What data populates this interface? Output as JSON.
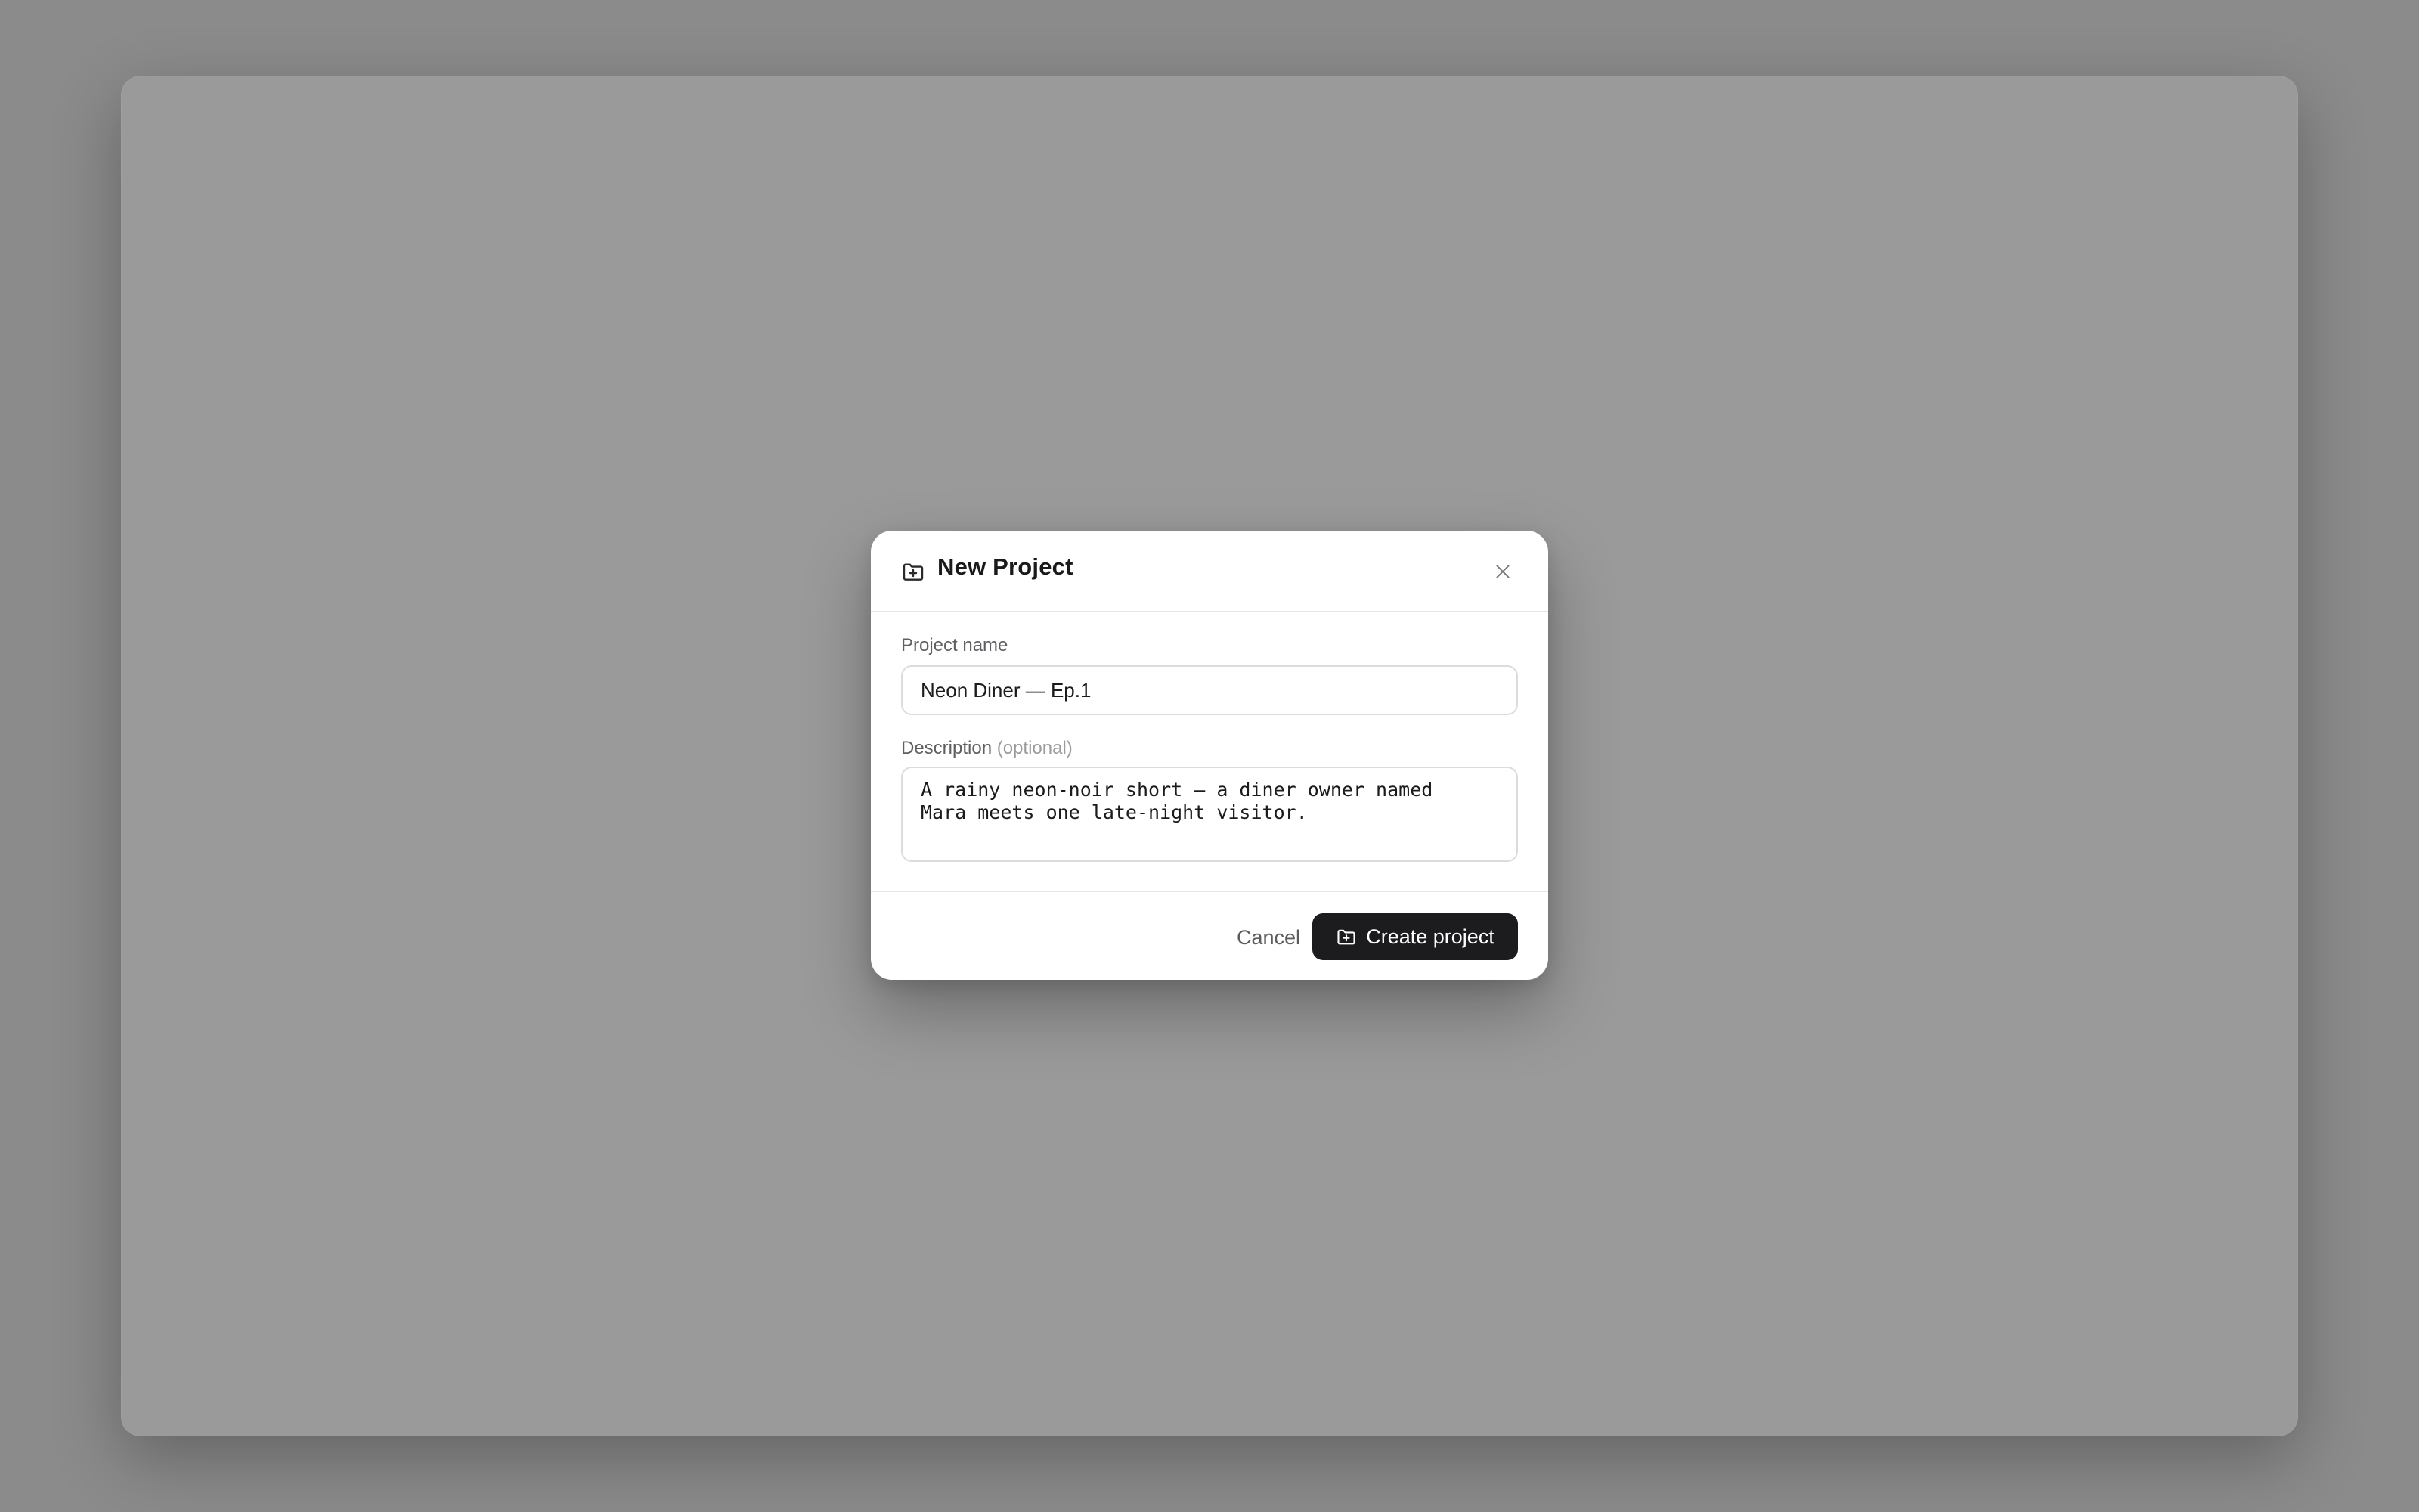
{
  "dialog": {
    "title": "New Project",
    "title_icon": "folder-plus-icon",
    "close_icon": "close-icon"
  },
  "form": {
    "name_label": "Project name",
    "name_value": "Neon Diner — Ep.1",
    "description_label": "Description",
    "description_hint": "(optional)",
    "description_value": "A rainy neon-noir short — a diner owner named\nMara meets one late-night visitor."
  },
  "footer": {
    "cancel_label": "Cancel",
    "create_label": "Create project",
    "create_icon": "folder-plus-icon"
  },
  "colors": {
    "primary_button": "#1c1c1f",
    "backdrop": "#8b8b8c"
  }
}
